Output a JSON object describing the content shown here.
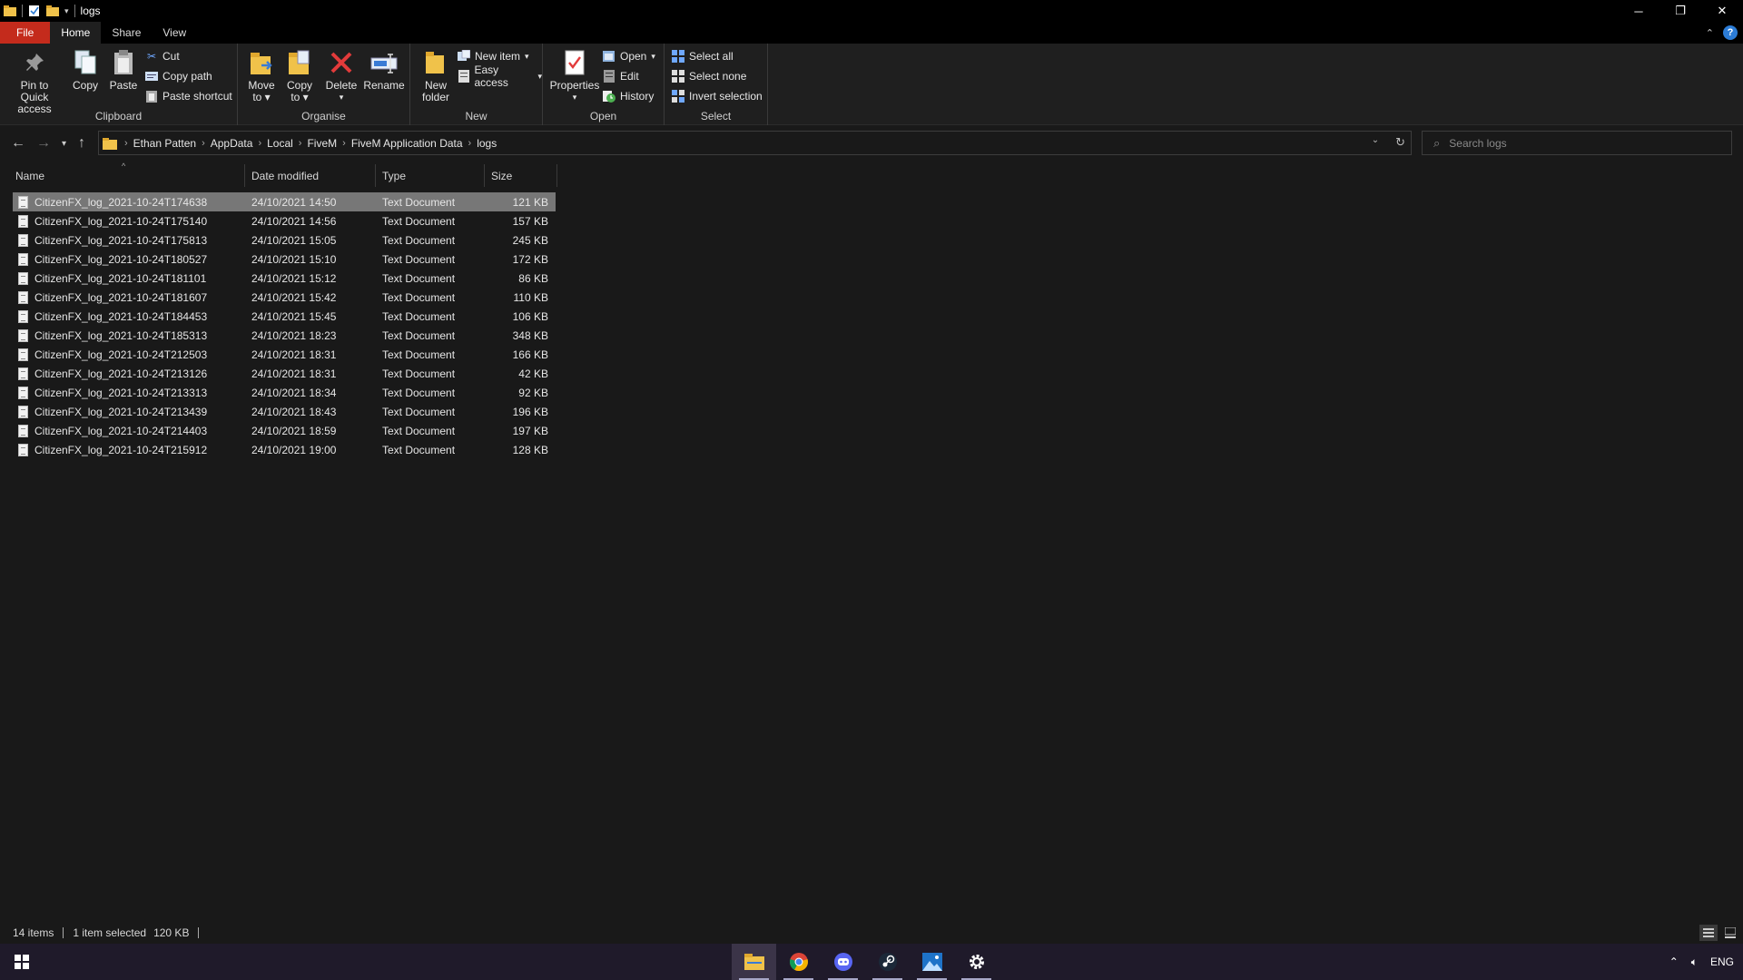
{
  "window": {
    "title": "logs"
  },
  "ribbon_tabs": [
    "File",
    "Home",
    "Share",
    "View"
  ],
  "ribbon": {
    "clipboard": {
      "label": "Clipboard",
      "pin_line1": "Pin to Quick",
      "pin_line2": "access",
      "copy": "Copy",
      "paste": "Paste",
      "cut": "Cut",
      "copy_path": "Copy path",
      "paste_shortcut": "Paste shortcut"
    },
    "organise": {
      "label": "Organise",
      "move_line1": "Move",
      "move_line2": "to",
      "copy_line1": "Copy",
      "copy_line2": "to",
      "delete": "Delete",
      "rename": "Rename"
    },
    "new": {
      "label": "New",
      "folder_line1": "New",
      "folder_line2": "folder",
      "new_item": "New item",
      "easy_access": "Easy access"
    },
    "open": {
      "label": "Open",
      "properties": "Properties",
      "open": "Open",
      "edit": "Edit",
      "history": "History"
    },
    "select": {
      "label": "Select",
      "select_all": "Select all",
      "select_none": "Select none",
      "invert": "Invert selection"
    }
  },
  "breadcrumb": [
    "Ethan Patten",
    "AppData",
    "Local",
    "FiveM",
    "FiveM Application Data",
    "logs"
  ],
  "search": {
    "placeholder": "Search logs"
  },
  "columns": {
    "name": "Name",
    "date": "Date modified",
    "type": "Type",
    "size": "Size"
  },
  "files": [
    {
      "name": "CitizenFX_log_2021-10-24T174638",
      "date": "24/10/2021 14:50",
      "type": "Text Document",
      "size": "121 KB",
      "selected": true
    },
    {
      "name": "CitizenFX_log_2021-10-24T175140",
      "date": "24/10/2021 14:56",
      "type": "Text Document",
      "size": "157 KB"
    },
    {
      "name": "CitizenFX_log_2021-10-24T175813",
      "date": "24/10/2021 15:05",
      "type": "Text Document",
      "size": "245 KB"
    },
    {
      "name": "CitizenFX_log_2021-10-24T180527",
      "date": "24/10/2021 15:10",
      "type": "Text Document",
      "size": "172 KB"
    },
    {
      "name": "CitizenFX_log_2021-10-24T181101",
      "date": "24/10/2021 15:12",
      "type": "Text Document",
      "size": "86 KB"
    },
    {
      "name": "CitizenFX_log_2021-10-24T181607",
      "date": "24/10/2021 15:42",
      "type": "Text Document",
      "size": "110 KB"
    },
    {
      "name": "CitizenFX_log_2021-10-24T184453",
      "date": "24/10/2021 15:45",
      "type": "Text Document",
      "size": "106 KB"
    },
    {
      "name": "CitizenFX_log_2021-10-24T185313",
      "date": "24/10/2021 18:23",
      "type": "Text Document",
      "size": "348 KB"
    },
    {
      "name": "CitizenFX_log_2021-10-24T212503",
      "date": "24/10/2021 18:31",
      "type": "Text Document",
      "size": "166 KB"
    },
    {
      "name": "CitizenFX_log_2021-10-24T213126",
      "date": "24/10/2021 18:31",
      "type": "Text Document",
      "size": "42 KB"
    },
    {
      "name": "CitizenFX_log_2021-10-24T213313",
      "date": "24/10/2021 18:34",
      "type": "Text Document",
      "size": "92 KB"
    },
    {
      "name": "CitizenFX_log_2021-10-24T213439",
      "date": "24/10/2021 18:43",
      "type": "Text Document",
      "size": "196 KB"
    },
    {
      "name": "CitizenFX_log_2021-10-24T214403",
      "date": "24/10/2021 18:59",
      "type": "Text Document",
      "size": "197 KB"
    },
    {
      "name": "CitizenFX_log_2021-10-24T215912",
      "date": "24/10/2021 19:00",
      "type": "Text Document",
      "size": "128 KB"
    }
  ],
  "status": {
    "items": "14 items",
    "selected": "1 item selected",
    "size": "120 KB"
  },
  "tray": {
    "lang": "ENG"
  },
  "colors": {
    "file_tab": "#c42b1c",
    "selected_row": "#777777",
    "taskbar": "#1f1a2a",
    "accent": "#2c7cd6"
  }
}
